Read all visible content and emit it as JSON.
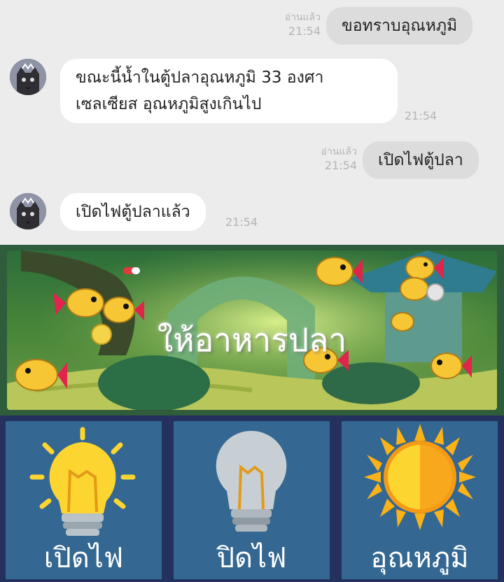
{
  "chat": {
    "messages": [
      {
        "direction": "out",
        "text": "ขอทราบอุณหภูมิ",
        "status": "อ่านแล้ว",
        "time": "21:54"
      },
      {
        "direction": "in",
        "lines": [
          "ขณะนี้น้ำในตู้ปลาอุณหภูมิ 33 องศา",
          "เซลเซียส อุณหภูมิสูงเกินไป"
        ],
        "time": "21:54"
      },
      {
        "direction": "out",
        "text": "เปิดไฟตู้ปลา",
        "status": "อ่านแล้ว",
        "time": "21:54"
      },
      {
        "direction": "in",
        "text": "เปิดไฟตู้ปลาแล้ว",
        "time": "21:54"
      }
    ]
  },
  "banner": {
    "label": "ให้อาหารปลา"
  },
  "controls": {
    "light_on": {
      "label": "เปิดไฟ",
      "icon": "lightbulb-on-icon"
    },
    "light_off": {
      "label": "ปิดไฟ",
      "icon": "lightbulb-off-icon"
    },
    "temperature": {
      "label": "อุณหภูมิ",
      "icon": "sun-icon"
    }
  },
  "colors": {
    "chat_bg": "#ececec",
    "outgoing_bubble": "#dcdcdc",
    "incoming_bubble": "#ffffff",
    "tile_bg": "#346791",
    "controls_bg": "#24305e",
    "bulb_yellow": "#fcd531",
    "sun_orange": "#fbb216"
  }
}
